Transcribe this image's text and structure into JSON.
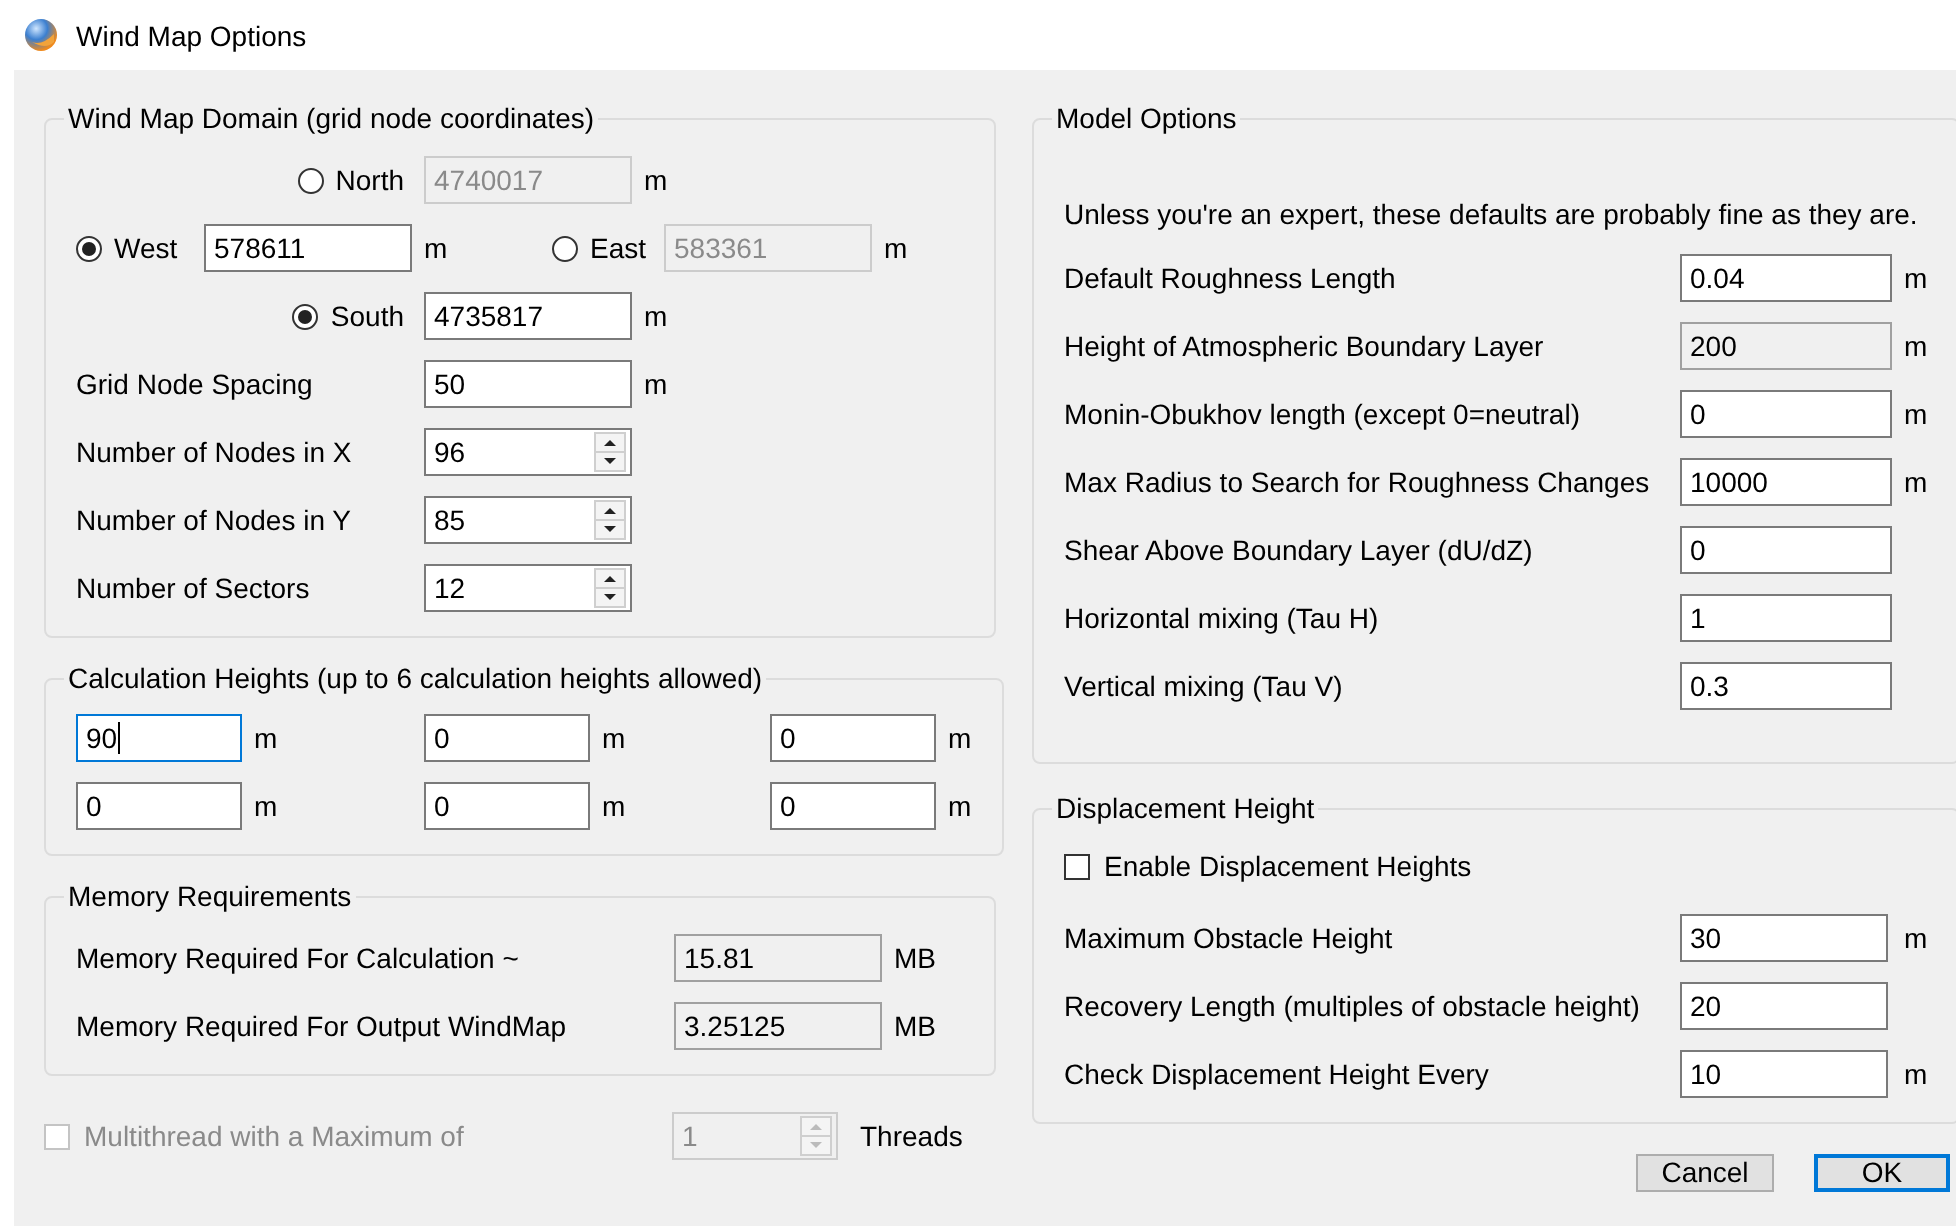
{
  "window": {
    "title": "Wind Map Options"
  },
  "domain": {
    "title": "Wind Map Domain (grid node coordinates)",
    "radios": [
      {
        "label": "North",
        "selected": false,
        "value": "4740017",
        "disabled": true,
        "unit": "m"
      },
      {
        "label": "West",
        "selected": true,
        "value": "578611",
        "disabled": false,
        "unit": "m"
      },
      {
        "label": "East",
        "selected": false,
        "value": "583361",
        "disabled": true,
        "unit": "m"
      },
      {
        "label": "South",
        "selected": true,
        "value": "4735817",
        "disabled": false,
        "unit": "m"
      }
    ],
    "fields": [
      {
        "label": "Grid Node Spacing",
        "kind": "text",
        "value": "50",
        "unit": "m"
      },
      {
        "label": "Number of Nodes in X",
        "kind": "spin",
        "value": "96"
      },
      {
        "label": "Number of Nodes in Y",
        "kind": "spin",
        "value": "85"
      },
      {
        "label": "Number of Sectors",
        "kind": "spin",
        "value": "12"
      }
    ]
  },
  "heights": {
    "title": "Calculation Heights (up to 6 calculation heights allowed)",
    "fields": [
      {
        "value": "90",
        "unit": "m",
        "focused": true
      },
      {
        "value": "0",
        "unit": "m",
        "focused": false
      },
      {
        "value": "0",
        "unit": "m",
        "focused": false
      },
      {
        "value": "0",
        "unit": "m",
        "focused": false
      },
      {
        "value": "0",
        "unit": "m",
        "focused": false
      },
      {
        "value": "0",
        "unit": "m",
        "focused": false
      }
    ]
  },
  "memory": {
    "title": "Memory Requirements",
    "fields": [
      {
        "label": "Memory Required For Calculation ~",
        "value": "15.81",
        "unit": "MB",
        "readonly": true
      },
      {
        "label": "Memory Required For Output WindMap",
        "value": "3.25125",
        "unit": "MB",
        "readonly": true
      }
    ]
  },
  "multithread": {
    "label": "Multithread with a Maximum of",
    "checked": false,
    "disabled": true,
    "value": "1",
    "unit": "Threads"
  },
  "model": {
    "title": "Model Options",
    "note": "Unless you're an expert, these defaults are probably fine as they are.",
    "fields": [
      {
        "label": "Default Roughness Length",
        "value": "0.04",
        "unit": "m",
        "readonly": false
      },
      {
        "label": "Height of Atmospheric Boundary Layer",
        "value": "200",
        "unit": "m",
        "readonly": true
      },
      {
        "label": "Monin-Obukhov length (except 0=neutral)",
        "value": "0",
        "unit": "m",
        "readonly": false
      },
      {
        "label": "Max Radius to Search for Roughness Changes",
        "value": "10000",
        "unit": "m",
        "readonly": false
      },
      {
        "label": "Shear Above Boundary Layer (dU/dZ)",
        "value": "0",
        "readonly": false
      },
      {
        "label": "Horizontal mixing (Tau H)",
        "value": "1",
        "readonly": false
      },
      {
        "label": "Vertical mixing (Tau V)",
        "value": "0.3",
        "readonly": false
      }
    ]
  },
  "displacement": {
    "title": "Displacement Height",
    "checkbox": {
      "label": "Enable Displacement Heights",
      "checked": false
    },
    "fields": [
      {
        "label": "Maximum Obstacle Height",
        "value": "30",
        "unit": "m",
        "readonly": false
      },
      {
        "label": "Recovery Length (multiples of obstacle height)",
        "value": "20",
        "readonly": false
      },
      {
        "label": "Check Displacement Height Every",
        "value": "10",
        "unit": "m",
        "readonly": false
      }
    ]
  },
  "buttons": [
    {
      "label": "Cancel",
      "default": false
    },
    {
      "label": "OK",
      "default": true
    }
  ]
}
